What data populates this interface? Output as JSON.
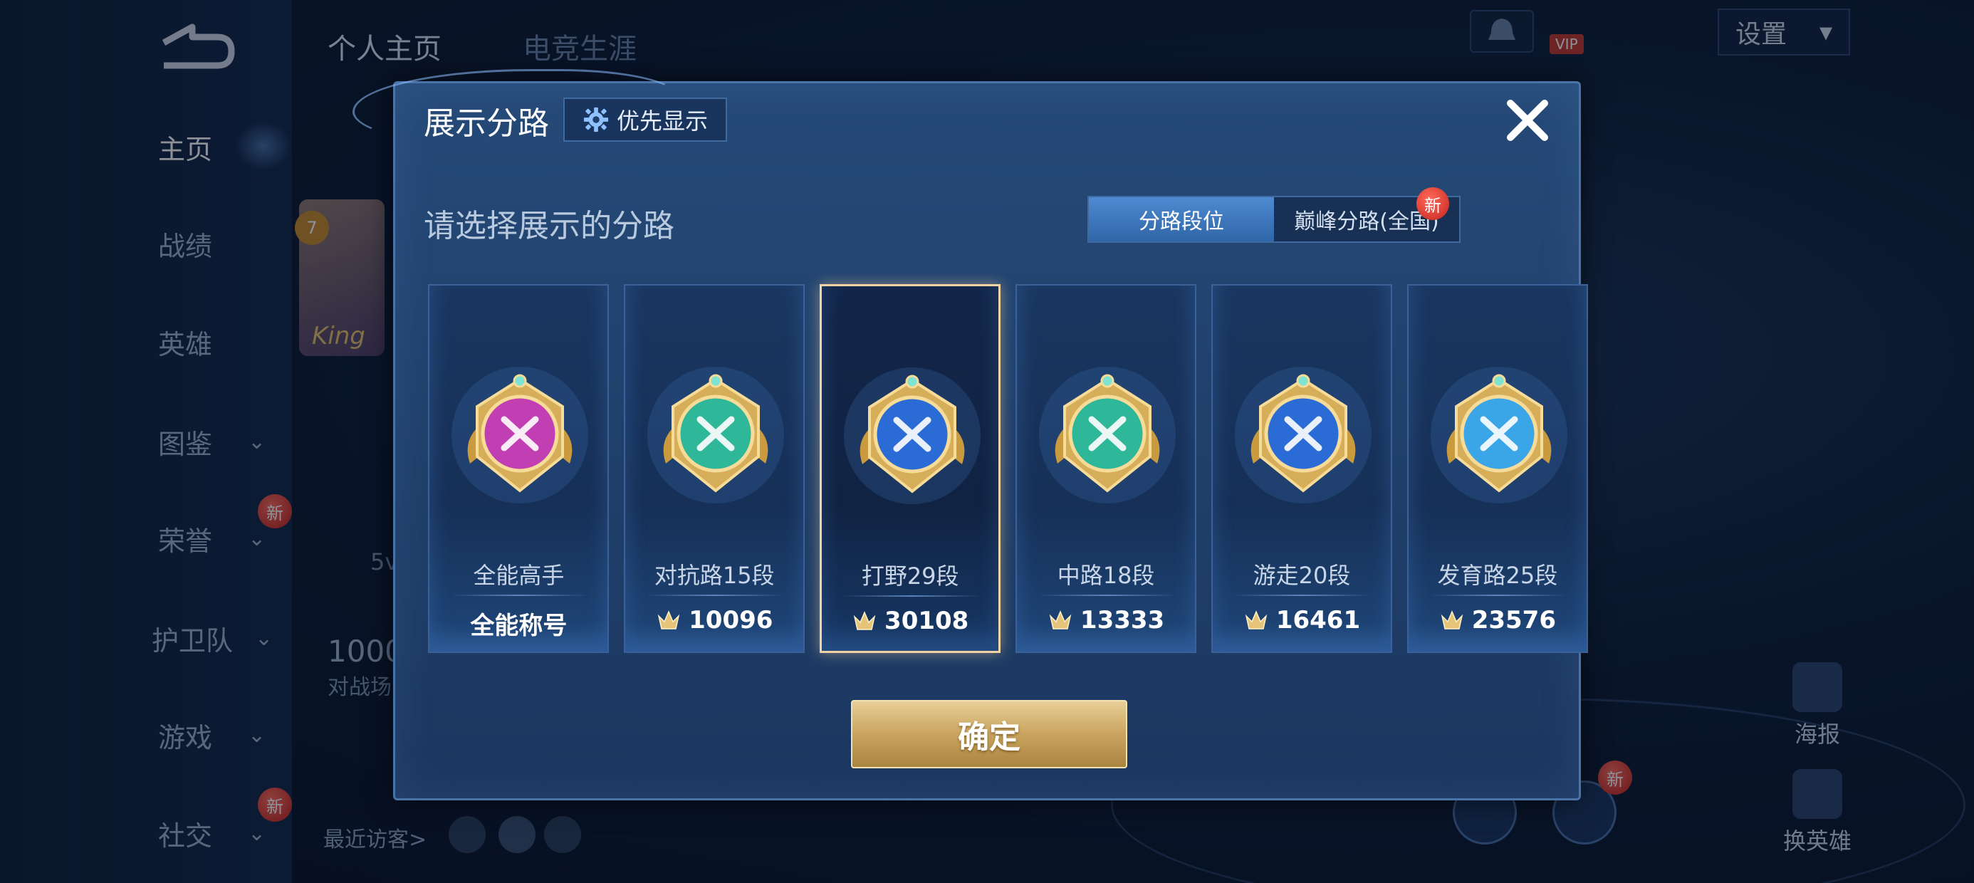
{
  "sidebar": {
    "items": [
      {
        "label": "主页",
        "active": true,
        "chevron": false
      },
      {
        "label": "战绩",
        "chevron": false
      },
      {
        "label": "英雄",
        "chevron": false
      },
      {
        "label": "图鉴",
        "chevron": true
      },
      {
        "label": "荣誉",
        "chevron": true,
        "new_badge": "新"
      },
      {
        "label": "护卫队",
        "chevron": true
      },
      {
        "label": "游戏",
        "chevron": true
      },
      {
        "label": "社交",
        "chevron": true,
        "new_badge": "新"
      }
    ]
  },
  "background": {
    "tabs": [
      "个人主页",
      "电竞生涯"
    ],
    "settings_label": "设置",
    "vip_label": "VIP",
    "poster_label": "海报",
    "change_hero_label": "换英雄",
    "recent_visitors": "最近访客>",
    "stat_value": "1000",
    "stat_label": "对战场",
    "hero_tag": "King",
    "level_badge": "7",
    "mode_text": "5v",
    "new_badge": "新"
  },
  "modal": {
    "title": "展示分路",
    "priority_button": "优先显示",
    "prompt": "请选择展示的分路",
    "segmented": [
      {
        "label": "分路段位",
        "active": true
      },
      {
        "label": "巅峰分路(全国)",
        "active": false,
        "new_badge": "新"
      }
    ],
    "cards": [
      {
        "name": "全能高手",
        "score": "全能称号",
        "has_icon": false,
        "color": "#c23fb3",
        "selected": false
      },
      {
        "name": "对抗路15段",
        "score": "10096",
        "has_icon": true,
        "color": "#2fb79a",
        "selected": false
      },
      {
        "name": "打野29段",
        "score": "30108",
        "has_icon": true,
        "color": "#2a6bd6",
        "selected": true
      },
      {
        "name": "中路18段",
        "score": "13333",
        "has_icon": true,
        "color": "#2fb79a",
        "selected": false
      },
      {
        "name": "游走20段",
        "score": "16461",
        "has_icon": true,
        "color": "#2a6bd6",
        "selected": false
      },
      {
        "name": "发育路25段",
        "score": "23576",
        "has_icon": true,
        "color": "#3aa6e8",
        "selected": false
      }
    ],
    "confirm_button": "确定"
  },
  "colors": {
    "gold": "#d9b874",
    "selected_border": "#f2d3a4",
    "accent_blue": "#4f8ad0",
    "new_red": "#d8312a"
  },
  "icons": [
    "back-arrow-icon",
    "gear-icon",
    "close-icon",
    "score-crown-icon",
    "chevron-down-icon",
    "bell-icon"
  ]
}
